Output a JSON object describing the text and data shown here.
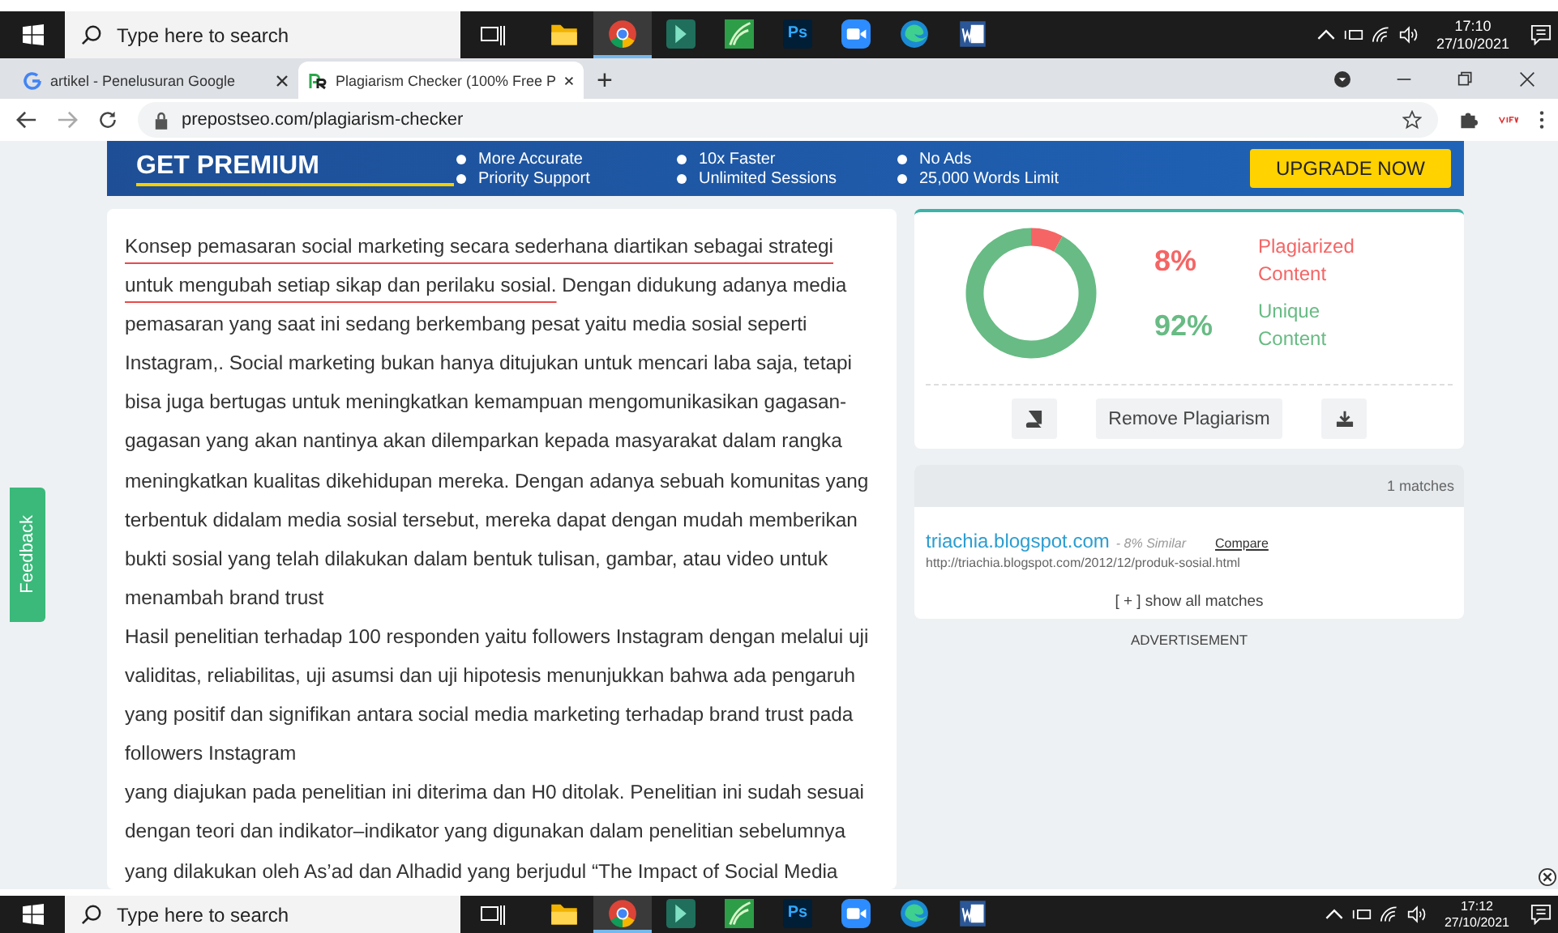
{
  "taskbar_top": {
    "search_placeholder": "Type here to search",
    "apps": [
      {
        "kind": "explorer",
        "selected": false
      },
      {
        "kind": "chrome",
        "selected": true
      },
      {
        "kind": "app",
        "selected": false
      },
      {
        "kind": "leaf",
        "selected": false
      },
      {
        "kind": "ps",
        "label": "Ps",
        "selected": false
      },
      {
        "kind": "zoom",
        "selected": false
      },
      {
        "kind": "edge",
        "selected": false
      },
      {
        "kind": "word",
        "selected": false
      }
    ],
    "time": "17:10",
    "date": "27/10/2021"
  },
  "browser": {
    "tabs": [
      {
        "title": "artikel - Penelusuran Google",
        "selected": false,
        "kind": "google"
      },
      {
        "title": "Plagiarism Checker (100% Free P",
        "selected": true,
        "kind": "pr"
      }
    ],
    "new_tab": "+",
    "url": "prepostseo.com/plagiarism-checker"
  },
  "banner": {
    "title": "GET PREMIUM",
    "features": [
      "More Accurate",
      "10x Faster",
      "No Ads",
      "Priority Support",
      "Unlimited Sessions",
      "25,000 Words Limit"
    ],
    "button": "UPGRADE NOW"
  },
  "document": {
    "paragraphs": [
      [
        {
          "text": "Konsep pemasaran social marketing secara sederhana diartikan sebagai strategi untuk mengubah setiap sikap dan perilaku sosial.",
          "highlighted": true
        },
        {
          "text": " Dengan didukung adanya media pemasaran yang saat ini sedang berkembang pesat yaitu media sosial seperti Instagram,. Social marketing bukan hanya ditujukan untuk mencari laba saja, tetapi bisa juga bertugas untuk meningkatkan kemampuan mengomunikasikan gagasan-gagasan yang akan nantinya akan dilemparkan kepada masyarakat dalam rangka meningkatkan kualitas dikehidupan mereka.  Dengan adanya sebuah komunitas yang terbentuk didalam media sosial tersebut, mereka dapat dengan mudah memberikan bukti sosial yang telah dilakukan dalam bentuk tulisan, gambar, atau video untuk menambah brand trust",
          "highlighted": false
        }
      ],
      [
        {
          "text": " Hasil penelitian terhadap 100 responden yaitu followers Instagram dengan melalui uji validitas, reliabilitas, uji asumsi dan uji hipotesis menunjukkan bahwa ada pengaruh yang positif dan signifikan antara social media marketing terhadap brand trust pada followers Instagram",
          "highlighted": false
        }
      ],
      [
        {
          "text": "  yang diajukan pada penelitian ini diterima dan H0 ditolak. Penelitian ini sudah sesuai dengan teori dan indikator–indikator yang digunakan dalam penelitian sebelumnya yang dilakukan oleh As’ad dan Alhadid yang berjudul “The Impact of Social Media",
          "highlighted": false
        }
      ]
    ]
  },
  "result": {
    "chart_data": {
      "type": "donut",
      "values": [
        8,
        92
      ]
    },
    "stats": [
      {
        "percent": "8%",
        "label": "Plagiarized Content",
        "color": "#f56565"
      },
      {
        "percent": "92%",
        "label": "Unique Content",
        "color": "#68bb84"
      }
    ],
    "remove_button": "Remove Plagiarism"
  },
  "matches": {
    "count": "1 matches",
    "items": [
      {
        "site": "triachia.blogspot.com",
        "similarity": "- 8% Similar",
        "compare": "Compare",
        "url": "http://triachia.blogspot.com/2012/12/produk-sosial.html"
      }
    ],
    "show_all": "[ + ] show all matches"
  },
  "advertisement": "ADVERTISEMENT",
  "feedback": "Feedback",
  "taskbar_bottom": {
    "search_placeholder": "Type here to search",
    "apps": [
      {
        "kind": "explorer",
        "selected": false
      },
      {
        "kind": "chrome",
        "selected": true
      },
      {
        "kind": "app",
        "selected": false
      },
      {
        "kind": "leaf",
        "selected": false
      },
      {
        "kind": "ps",
        "label": "Ps",
        "selected": false
      },
      {
        "kind": "zoom",
        "selected": false
      },
      {
        "kind": "edge",
        "selected": false
      },
      {
        "kind": "word",
        "selected": false
      }
    ],
    "time": "17:12",
    "date": "27/10/2021"
  }
}
